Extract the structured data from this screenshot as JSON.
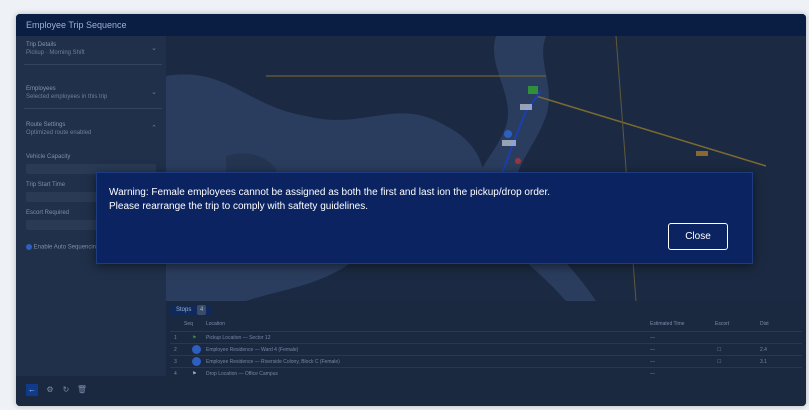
{
  "window": {
    "title": "Employee Trip Sequence"
  },
  "sidebar": {
    "fields": [
      {
        "label": "Trip Details",
        "value": "Pickup · Morning Shift"
      },
      {
        "label": "Employees",
        "value": "Selected employees in this trip"
      },
      {
        "label": "Route Settings",
        "value": "Optimized route enabled"
      }
    ],
    "inputs": [
      {
        "label": "Vehicle Capacity"
      },
      {
        "label": "Trip Start Time"
      },
      {
        "label": "Escort Required"
      }
    ],
    "checkbox_label": "Enable Auto Sequencing"
  },
  "stops": {
    "tab_label": "Stops",
    "count": "4",
    "columns": [
      "Seq",
      "Location",
      "Estimated Time",
      "Escort",
      "Dist"
    ],
    "rows": [
      {
        "seq": "1",
        "location": "Pickup Location — Sector 12",
        "time": "—",
        "escort": "",
        "dist": ""
      },
      {
        "seq": "2",
        "location": "Employee Residence — Ward 4 (Female)",
        "time": "—",
        "escort": "☐",
        "dist": "2.4"
      },
      {
        "seq": "3",
        "location": "Employee Residence — Riverside Colony, Block C (Female)",
        "time": "—",
        "escort": "☐",
        "dist": "3.1"
      },
      {
        "seq": "4",
        "location": "Drop Location — Office Campus",
        "time": "—",
        "escort": "",
        "dist": ""
      }
    ]
  },
  "dialog": {
    "message_line1": "Warning: Female employees cannot be assigned as both the first and last ion the pickup/drop order.",
    "message_line2": "Please rearrange the trip to comply with saftety guidelines.",
    "close_label": "Close"
  },
  "colors": {
    "dialog_bg": "#0b2361",
    "overlay_dim": "#0c1a33",
    "accent": "#2d5fbf"
  },
  "icons": {
    "flag": "flag-icon",
    "stop": "map-pin-icon",
    "settings": "gear-icon",
    "delete": "trash-icon",
    "chevron": "chevron-down-icon"
  }
}
